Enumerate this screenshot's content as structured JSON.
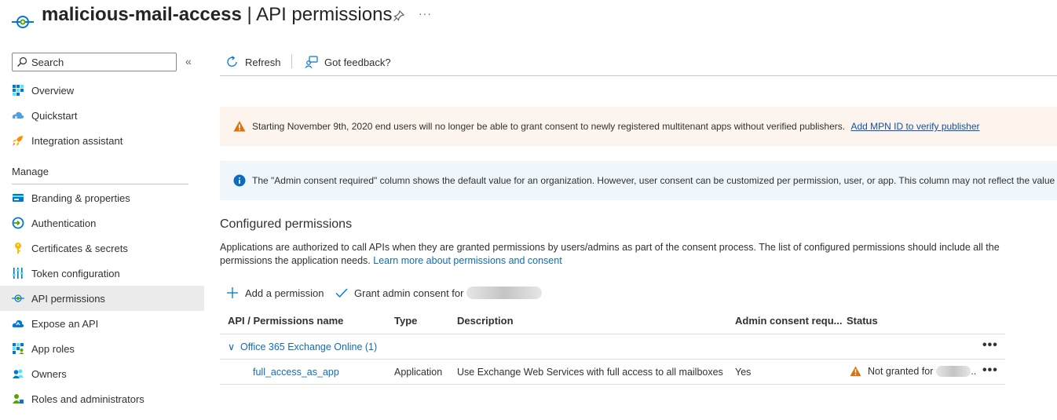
{
  "header": {
    "app_name": "malicious-mail-access",
    "separator": " | ",
    "page_name": "API permissions",
    "more_glyph": "···"
  },
  "sidebar": {
    "search_placeholder": "Search",
    "collapse_glyph": "«",
    "manage_header": "Manage",
    "items_top": [
      {
        "label": "Overview",
        "icon": "overview-grid-icon"
      },
      {
        "label": "Quickstart",
        "icon": "cloud-quickstart-icon"
      },
      {
        "label": "Integration assistant",
        "icon": "rocket-icon"
      }
    ],
    "items_manage": [
      {
        "label": "Branding & properties",
        "icon": "branding-card-icon"
      },
      {
        "label": "Authentication",
        "icon": "authentication-icon"
      },
      {
        "label": "Certificates & secrets",
        "icon": "key-icon"
      },
      {
        "label": "Token configuration",
        "icon": "token-sliders-icon"
      },
      {
        "label": "API permissions",
        "icon": "api-permissions-icon",
        "active": true
      },
      {
        "label": "Expose an API",
        "icon": "expose-cloud-icon"
      },
      {
        "label": "App roles",
        "icon": "app-roles-grid-icon"
      },
      {
        "label": "Owners",
        "icon": "owners-people-icon"
      },
      {
        "label": "Roles and administrators",
        "icon": "roles-admin-icon"
      }
    ]
  },
  "toolbar": {
    "refresh_label": "Refresh",
    "feedback_label": "Got feedback?"
  },
  "banners": {
    "warning_text": "Starting November 9th, 2020 end users will no longer be able to grant consent to newly registered multitenant apps without verified publishers.",
    "warning_link": "Add MPN ID to verify publisher",
    "info_text": "The \"Admin consent required\" column shows the default value for an organization. However, user consent can be customized per permission, user, or app. This column may not reflect the value in"
  },
  "configured": {
    "title": "Configured permissions",
    "description": "Applications are authorized to call APIs when they are granted permissions by users/admins as part of the consent process. The list of configured permissions should include all the permissions the application needs.",
    "learn_more": "Learn more about permissions and consent",
    "add_permission_label": "Add a permission",
    "grant_consent_label": "Grant admin consent for"
  },
  "table": {
    "headers": {
      "name": "API / Permissions name",
      "type": "Type",
      "description": "Description",
      "admin_consent": "Admin consent requ...",
      "status": "Status"
    },
    "group": {
      "chevron": "∨",
      "label": "Office 365 Exchange Online (1)"
    },
    "row": {
      "name": "full_access_as_app",
      "type": "Application",
      "description": "Use Exchange Web Services with full access to all mailboxes",
      "admin_consent": "Yes",
      "status": "Not granted for",
      "status_trail": ".."
    },
    "more_glyph": "•••"
  },
  "colors": {
    "accent": "#0f6cbd",
    "warning": "#d9730d",
    "info": "#0f6cbd",
    "active_nav": "#ebebeb"
  }
}
